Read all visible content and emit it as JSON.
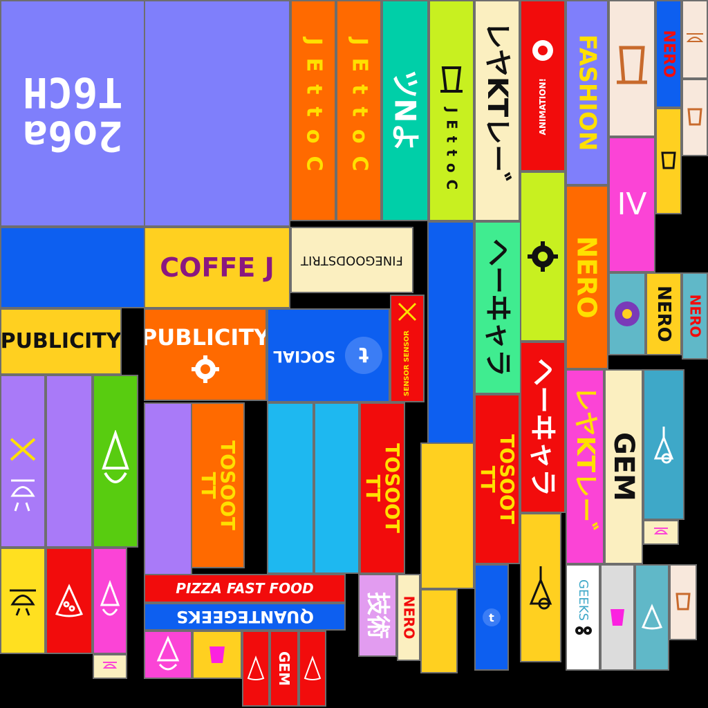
{
  "labels": {
    "soda_tech": "2o6a\nT6CH",
    "coffee_vert": "JEttoC",
    "katakana_a": "ツNよ",
    "katakana_b": "レヤKTレー゛",
    "katakana_c": "ヘーヰャラ",
    "katakana_d": "ヘーヰャラ",
    "katakana_e": "レヤKTレー゛",
    "animation": "ANIMATION!",
    "fashion": "FASHION",
    "nero": "NERO",
    "nero2": "NERO",
    "nero3": "NERO",
    "nero4": "NERO",
    "coffee_h": "COFFE J",
    "fine_goods": "FINEGOODSTRIT",
    "publicity_a": "PUBLICITY",
    "publicity_b": "PUBLICITY",
    "social": "SOCIAL",
    "sensor": "SENSOR SENSOR",
    "fast_food": "PIZZA FAST FOOD",
    "quantum_geeks": "QUANTEGEEKS",
    "food": "FOOD",
    "food2": "FOOD",
    "tf_a": "TOSOOT\nTT",
    "tf_b": "TOSOOT\nTT",
    "tf_c": "TOSOOT\nTT",
    "four": "IV",
    "geeks": "GEEKS",
    "kanji": "技術",
    "gem_a": "GEM",
    "gem_b": "GEM"
  },
  "colors": {
    "periwinkle": "#7f7ffb",
    "blue": "#0d5ff0",
    "orange": "#ff6a00",
    "teal": "#00cfa8",
    "lime": "#c8f020",
    "cream": "#fbefc0",
    "red": "#f20c0c",
    "yellow": "#ffd020",
    "green": "#58cc10",
    "purple": "#a97af8",
    "pink": "#fb44d6",
    "cyan": "#1eb8f0",
    "mint": "#40ec90",
    "peach": "#f8e8dc",
    "steel": "#3ea8c8"
  }
}
